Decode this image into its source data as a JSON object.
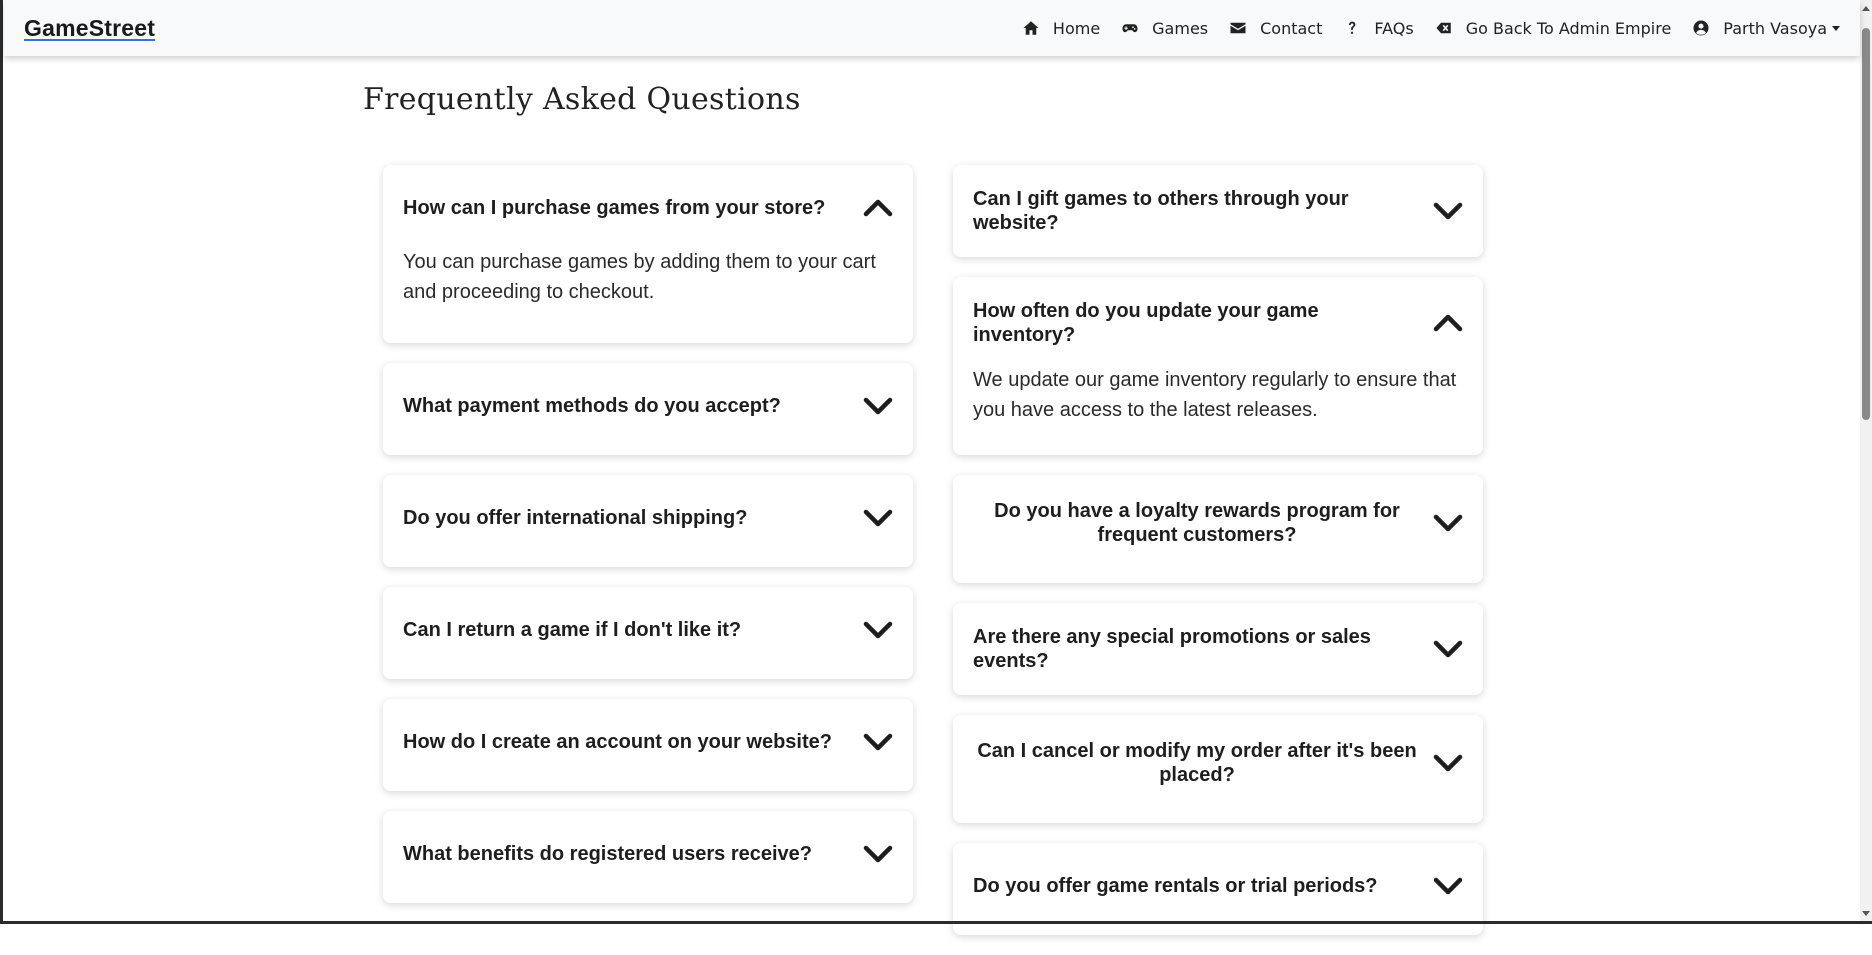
{
  "navbar": {
    "brand": "GameStreet",
    "items": [
      {
        "label": "Home",
        "icon": "home-icon"
      },
      {
        "label": "Games",
        "icon": "gamepad-icon"
      },
      {
        "label": "Contact",
        "icon": "envelope-icon"
      },
      {
        "label": "FAQs",
        "icon": "question-icon"
      },
      {
        "label": "Go Back To Admin Empire",
        "icon": "backspace-icon"
      },
      {
        "label": "Parth Vasoya",
        "icon": "user-circle-icon"
      }
    ]
  },
  "page": {
    "title": "Frequently Asked Questions"
  },
  "faq_left": [
    {
      "question": "How can I purchase games from your store?",
      "expanded": true,
      "answer": "You can purchase games by adding them to your cart and proceeding to checkout."
    },
    {
      "question": "What payment methods do you accept?",
      "expanded": false
    },
    {
      "question": "Do you offer international shipping?",
      "expanded": false
    },
    {
      "question": "Can I return a game if I don't like it?",
      "expanded": false
    },
    {
      "question": "How do I create an account on your website?",
      "expanded": false
    },
    {
      "question": "What benefits do registered users receive?",
      "expanded": false
    }
  ],
  "faq_right": [
    {
      "question": "Can I gift games to others through your website?",
      "expanded": false
    },
    {
      "question": "How often do you update your game inventory?",
      "expanded": true,
      "answer": "We update our game inventory regularly to ensure that you have access to the latest releases."
    },
    {
      "question": "Do you have a loyalty rewards program for frequent customers?",
      "expanded": false
    },
    {
      "question": "Are there any special promotions or sales events?",
      "expanded": false
    },
    {
      "question": "Can I cancel or modify my order after it's been placed?",
      "expanded": false
    },
    {
      "question": "Do you offer game rentals or trial periods?",
      "expanded": false
    }
  ]
}
